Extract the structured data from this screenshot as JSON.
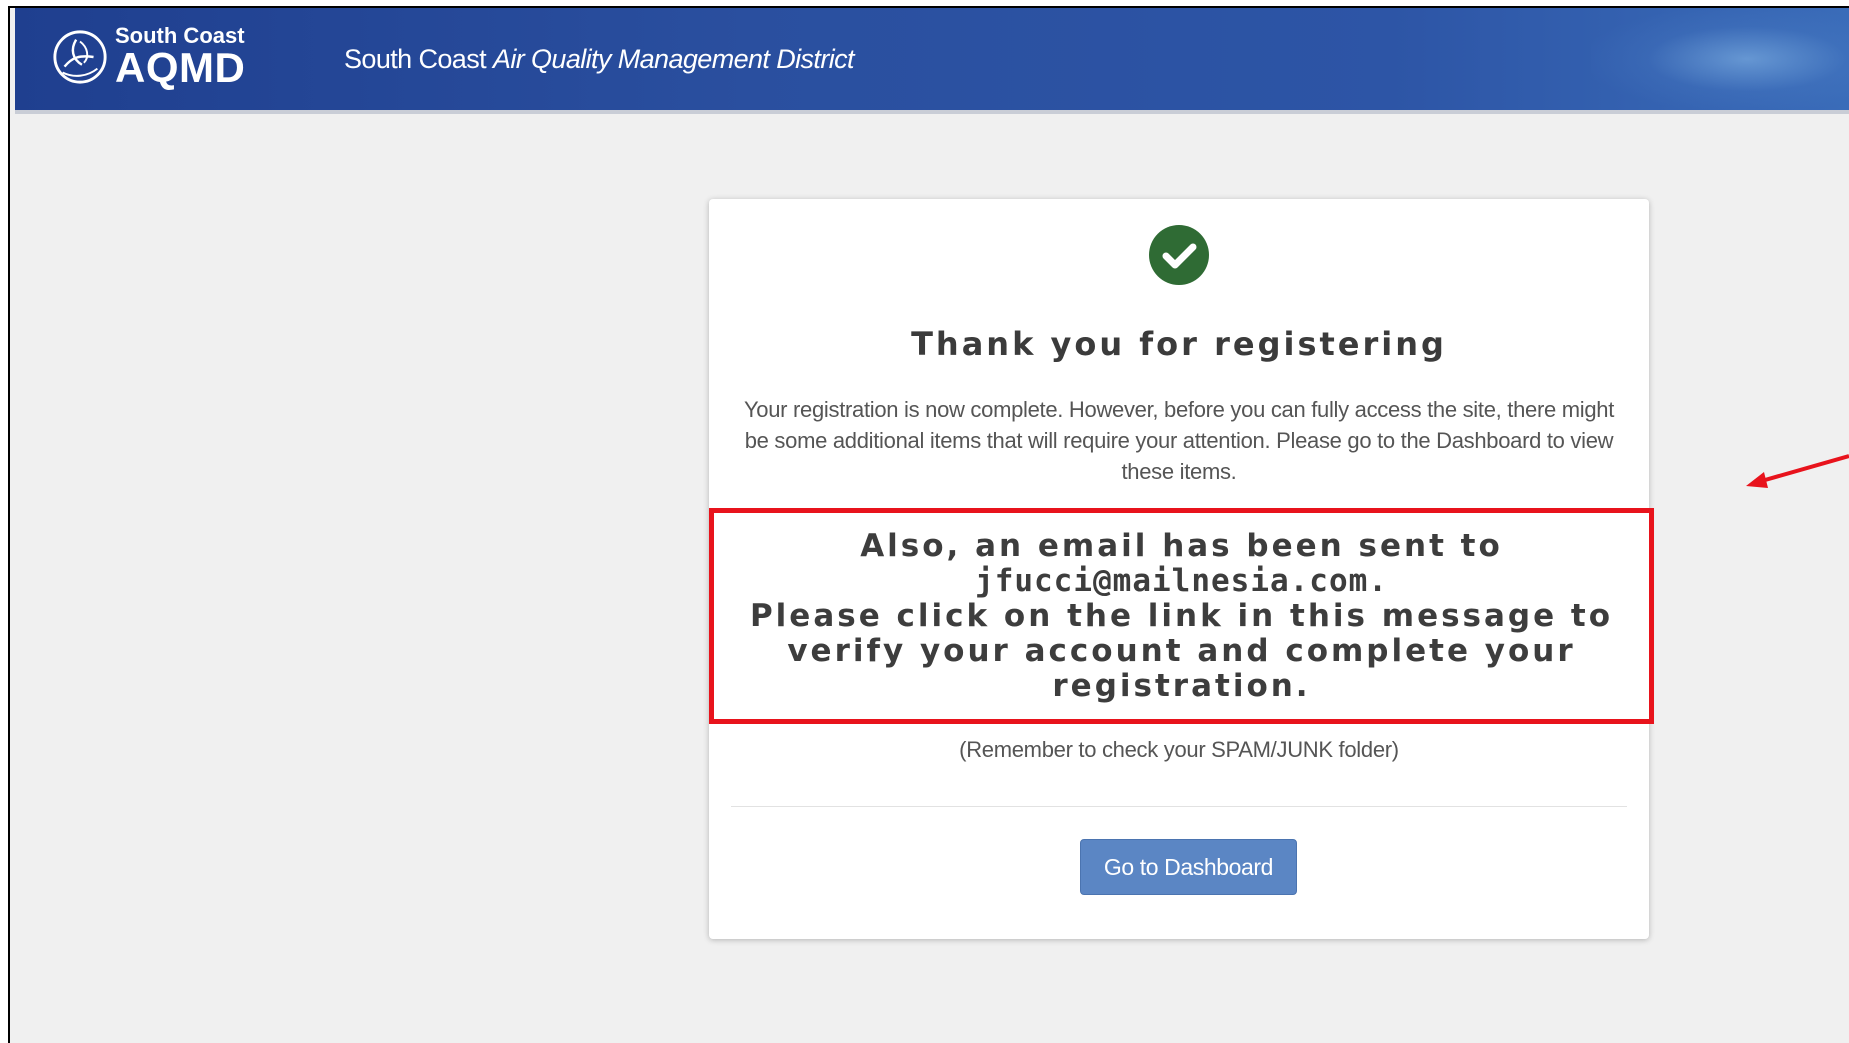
{
  "header": {
    "logo_small": "South Coast",
    "logo_big": "AQMD",
    "title_plain": "South Coast ",
    "title_italic": "Air Quality Management District",
    "colors": {
      "header_bg": "#2a4f9f",
      "header_text": "#ffffff"
    }
  },
  "card": {
    "icon": "check-circle-icon",
    "icon_color": "#2f6b34",
    "title": "Thank you for registering",
    "body": "Your registration is now complete. However, before you can fully access the site, there might be some additional items that will require your attention. Please go to the Dashboard to view these items.",
    "email_notice": {
      "line1": "Also, an email has been sent to",
      "email": "jfucci@mailnesia.com.",
      "line2": "Please click on the link in this message to verify your account and complete your registration."
    },
    "spam_note": "(Remember to check your SPAM/JUNK folder)",
    "button_label": "Go to Dashboard",
    "button_color": "#5b86c4"
  },
  "annotations": {
    "highlight_box_color": "#e8131c",
    "arrow_color": "#e8131c",
    "arrow_icon": "arrow-left-icon"
  }
}
